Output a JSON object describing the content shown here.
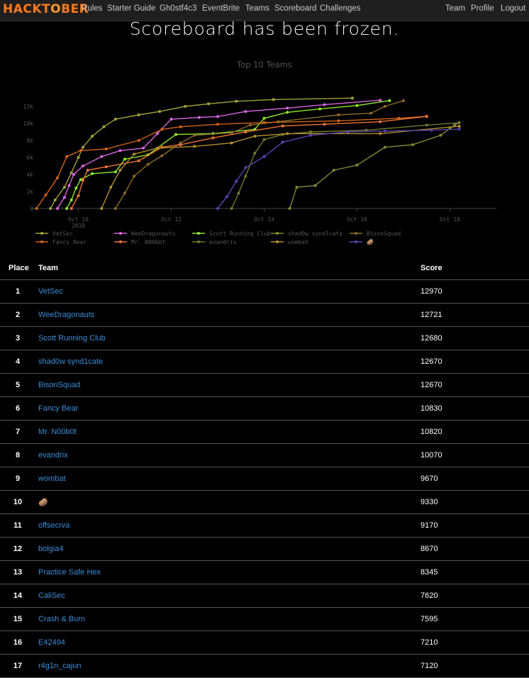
{
  "nav": {
    "brand_left": "HACKT",
    "brand_pumpkin": "O",
    "brand_right": "BER",
    "links": [
      "Rules",
      "Starter Guide",
      "Gh0stf4c3",
      "EventBrite",
      "Teams",
      "Scoreboard",
      "Challenges"
    ],
    "right_links": [
      "Team",
      "Profile",
      "Logout"
    ]
  },
  "banner": "Scoreboard has been frozen.",
  "table": {
    "headers": {
      "place": "Place",
      "team": "Team",
      "score": "Score"
    },
    "rows": [
      {
        "place": "1",
        "team": "VetSec",
        "score": "12970"
      },
      {
        "place": "2",
        "team": "WeeDragonauts",
        "score": "12721"
      },
      {
        "place": "3",
        "team": "Scott Running Club",
        "score": "12680"
      },
      {
        "place": "4",
        "team": "shad0w synd1cate",
        "score": "12670"
      },
      {
        "place": "5",
        "team": "BisonSquad",
        "score": "12670"
      },
      {
        "place": "6",
        "team": "Fancy Bear",
        "score": "10830"
      },
      {
        "place": "7",
        "team": "Mr. N00b0t",
        "score": "10820"
      },
      {
        "place": "8",
        "team": "evandrix",
        "score": "10070"
      },
      {
        "place": "9",
        "team": "wombat",
        "score": "9670"
      },
      {
        "place": "10",
        "team": "🥔",
        "score": "9330"
      },
      {
        "place": "11",
        "team": "offsecrva",
        "score": "9170"
      },
      {
        "place": "12",
        "team": "bolgia4",
        "score": "8670"
      },
      {
        "place": "13",
        "team": "Practice Safe Hex",
        "score": "8345"
      },
      {
        "place": "14",
        "team": "CaliSec",
        "score": "7620"
      },
      {
        "place": "15",
        "team": "Crash & Burn",
        "score": "7595"
      },
      {
        "place": "16",
        "team": "E42494",
        "score": "7210"
      },
      {
        "place": "17",
        "team": "r4g1n_cajun",
        "score": "7120"
      }
    ]
  },
  "chart_data": {
    "type": "line",
    "title": "Top 10 Teams",
    "xlabel": "",
    "ylabel": "",
    "x_ticks": [
      "Oct 10\n2018",
      "Oct 12",
      "Oct 14",
      "Oct 16",
      "Oct 18"
    ],
    "x_tick_days": [
      10,
      12,
      14,
      16,
      18
    ],
    "xlim": [
      9,
      19
    ],
    "y_ticks": [
      "0",
      "2k",
      "4k",
      "6k",
      "8k",
      "10k",
      "12k"
    ],
    "ylim": [
      0,
      13000
    ],
    "legend_position": "bottom-left",
    "series": [
      {
        "name": "VetSec",
        "color": "#a3a23a",
        "points": [
          [
            9.4,
            0
          ],
          [
            9.5,
            1000
          ],
          [
            9.7,
            2500
          ],
          [
            9.85,
            4200
          ],
          [
            10.0,
            6000
          ],
          [
            10.1,
            7200
          ],
          [
            10.3,
            8500
          ],
          [
            10.55,
            9600
          ],
          [
            10.8,
            10500
          ],
          [
            11.3,
            11000
          ],
          [
            11.75,
            11400
          ],
          [
            12.3,
            12000
          ],
          [
            12.8,
            12300
          ],
          [
            13.4,
            12600
          ],
          [
            14.2,
            12800
          ],
          [
            15.9,
            12970
          ]
        ]
      },
      {
        "name": "WeeDragonauts",
        "color": "#d966e0",
        "points": [
          [
            9.55,
            0
          ],
          [
            9.7,
            1300
          ],
          [
            9.8,
            2700
          ],
          [
            9.9,
            4000
          ],
          [
            10.1,
            5000
          ],
          [
            10.5,
            6100
          ],
          [
            10.9,
            6800
          ],
          [
            11.4,
            7100
          ],
          [
            11.7,
            8800
          ],
          [
            12.0,
            10500
          ],
          [
            12.6,
            10700
          ],
          [
            13.0,
            10800
          ],
          [
            13.6,
            11400
          ],
          [
            14.5,
            11800
          ],
          [
            15.3,
            12200
          ],
          [
            16.5,
            12721
          ]
        ]
      },
      {
        "name": "Scott Running Club",
        "color": "#8ee62f",
        "points": [
          [
            9.75,
            0
          ],
          [
            9.85,
            1000
          ],
          [
            9.95,
            2400
          ],
          [
            10.05,
            3400
          ],
          [
            10.3,
            4100
          ],
          [
            10.8,
            4300
          ],
          [
            11.0,
            5800
          ],
          [
            11.5,
            6300
          ],
          [
            12.1,
            8700
          ],
          [
            12.9,
            8800
          ],
          [
            13.8,
            9300
          ],
          [
            14.0,
            10600
          ],
          [
            14.5,
            11300
          ],
          [
            15.2,
            11700
          ],
          [
            16.0,
            12100
          ],
          [
            16.7,
            12680
          ]
        ]
      },
      {
        "name": "shad0w synd1cate",
        "color": "#7f8a32",
        "points": [
          [
            14.55,
            0
          ],
          [
            14.7,
            2500
          ],
          [
            15.1,
            2700
          ],
          [
            15.5,
            4500
          ],
          [
            16.0,
            5100
          ],
          [
            16.6,
            7200
          ],
          [
            17.2,
            7500
          ],
          [
            17.8,
            8600
          ],
          [
            18.0,
            9400
          ],
          [
            18.1,
            9800
          ],
          [
            18.2,
            10100
          ]
        ]
      },
      {
        "name": "BisonSquad",
        "color": "#8a6a2a",
        "points": [
          [
            10.8,
            0
          ],
          [
            11.0,
            1800
          ],
          [
            11.2,
            3800
          ],
          [
            11.5,
            5200
          ],
          [
            11.8,
            6200
          ],
          [
            12.2,
            7700
          ],
          [
            12.5,
            8600
          ],
          [
            13.3,
            8900
          ],
          [
            13.7,
            9800
          ],
          [
            14.3,
            10200
          ],
          [
            15.6,
            11000
          ],
          [
            16.3,
            11200
          ],
          [
            16.6,
            12000
          ],
          [
            17.0,
            12670
          ]
        ]
      },
      {
        "name": "Fancy Bear",
        "color": "#d2631a",
        "points": [
          [
            9.1,
            0
          ],
          [
            9.3,
            1600
          ],
          [
            9.55,
            3600
          ],
          [
            9.75,
            6100
          ],
          [
            10.05,
            6800
          ],
          [
            10.6,
            7000
          ],
          [
            11.3,
            8000
          ],
          [
            11.8,
            9300
          ],
          [
            12.2,
            9600
          ],
          [
            13.0,
            9900
          ],
          [
            14.0,
            10100
          ],
          [
            15.6,
            10300
          ],
          [
            16.9,
            10600
          ],
          [
            17.5,
            10830
          ]
        ]
      },
      {
        "name": "Mr. N00b0t",
        "color": "#f07238",
        "points": [
          [
            9.85,
            0
          ],
          [
            10.0,
            1500
          ],
          [
            10.1,
            3300
          ],
          [
            10.2,
            4500
          ],
          [
            10.6,
            4900
          ],
          [
            11.3,
            5600
          ],
          [
            11.8,
            7200
          ],
          [
            12.2,
            7500
          ],
          [
            12.9,
            8300
          ],
          [
            13.6,
            9000
          ],
          [
            14.4,
            9700
          ],
          [
            15.3,
            9900
          ],
          [
            16.5,
            10200
          ],
          [
            17.5,
            10820
          ]
        ]
      },
      {
        "name": "evandrix",
        "color": "#717a2e",
        "points": [
          [
            13.3,
            0
          ],
          [
            13.45,
            1800
          ],
          [
            13.6,
            3800
          ],
          [
            13.8,
            6500
          ],
          [
            14.0,
            8100
          ],
          [
            14.4,
            8700
          ],
          [
            15.0,
            9000
          ],
          [
            16.2,
            9200
          ],
          [
            17.5,
            9800
          ],
          [
            18.2,
            10070
          ]
        ]
      },
      {
        "name": "wombat",
        "color": "#b38f2c",
        "points": [
          [
            10.5,
            0
          ],
          [
            10.7,
            2500
          ],
          [
            10.9,
            4500
          ],
          [
            11.2,
            6400
          ],
          [
            11.7,
            7100
          ],
          [
            12.5,
            7300
          ],
          [
            13.3,
            7700
          ],
          [
            13.8,
            8500
          ],
          [
            14.5,
            8800
          ],
          [
            16.5,
            8800
          ],
          [
            18.2,
            9670
          ]
        ]
      },
      {
        "name": "🥔",
        "color": "#5b42b0",
        "points": [
          [
            13.0,
            0
          ],
          [
            13.2,
            1400
          ],
          [
            13.4,
            3200
          ],
          [
            13.6,
            4800
          ],
          [
            14.0,
            6100
          ],
          [
            14.4,
            7800
          ],
          [
            15.0,
            8600
          ],
          [
            15.8,
            9000
          ],
          [
            16.6,
            9100
          ],
          [
            17.6,
            9200
          ],
          [
            18.2,
            9330
          ]
        ]
      }
    ]
  }
}
